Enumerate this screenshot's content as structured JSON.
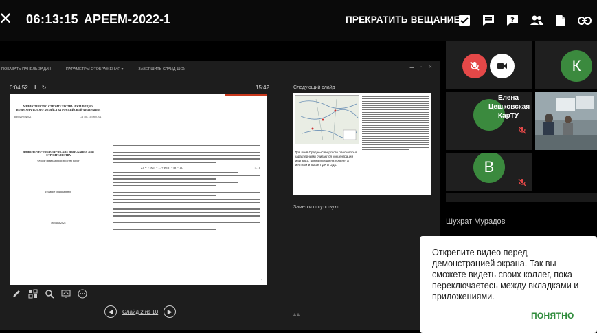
{
  "topbar": {
    "timer": "06:13:15",
    "title": "APEEM-2022-1",
    "stop_label": "ПРЕКРАТИТЬ ВЕЩАНИЕ",
    "icons": [
      "tasks-icon",
      "chat-icon",
      "help-icon",
      "people-icon",
      "file-icon",
      "link-icon"
    ]
  },
  "presenter": {
    "toolbar": [
      "ПОКАЗАТЬ ПАНЕЛЬ ЗАДАЧ",
      "ПАРАМЕТРЫ ОТОБРАЖЕНИЯ ▾",
      "ЗАВЕРШИТЬ СЛАЙД-ШОУ"
    ],
    "elapsed": "0:04:52",
    "clock": "15:42",
    "next_slide_label": "Следующий слайд",
    "notes_label": "Заметки отсутствуют.",
    "slide_counter": "Слайд 2 из 10",
    "font_controls": "A  A"
  },
  "slide": {
    "header_left": "МИНИСТЕРСТВО СТРОИТЕЛЬСТВА И ЖИЛИЩНО-КОММУНАЛЬНОГО ХОЗЯЙСТВА РОССИЙСКОЙ ФЕДЕРАЦИИ",
    "doc_code": "СП 502.1325800.2021",
    "doc_title": "ИНЖЕНЕРНО-ЭКОЛОГИЧЕСКИЕ ИЗЫСКАНИЯ ДЛЯ СТРОИТЕЛЬСТВА",
    "doc_subtitle": "Общие правила производства работ",
    "edition": "Издание официальное",
    "city_year": "Москва 2021",
    "formula": "Zс = ∑(Kci + ... + Kcn) − (n − 1),",
    "formula_no": "(5.1)",
    "page_no": "2"
  },
  "next_slide": {
    "caption": "Для почв Средне-Сибирского плоскогорья характерными считаются концентрации марганца, цинка и меди на уровне, а местами и выше ПДК и ОДК."
  },
  "participants": {
    "tile_k": "К",
    "tile_v": "В",
    "presenter_name": "Елена Цешковская КарТУ",
    "name_below": "Шухрат Мурадов"
  },
  "toast": {
    "message": "Открепите видео перед демонстрацией экрана. Так вы сможете видеть своих коллег, пока переключаетесь между вкладками и приложениями.",
    "button": "ПОНЯТНО"
  },
  "colors": {
    "avatar_green": "#3b8a3e",
    "mic_red": "#e54848",
    "accent_green": "#2e8b3a"
  }
}
